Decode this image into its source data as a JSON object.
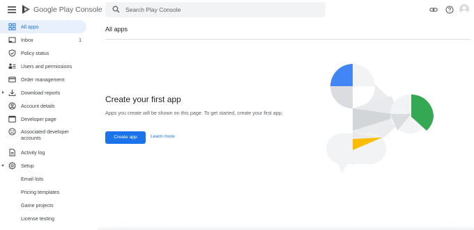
{
  "header": {
    "brand_google": "Google Play",
    "brand_product": "Console",
    "search_placeholder": "Search Play Console",
    "icons": [
      "menu-icon",
      "link-icon",
      "help-icon",
      "avatar"
    ]
  },
  "sidebar": {
    "items": [
      {
        "label": "All apps",
        "icon": "apps-grid-icon",
        "active": true
      },
      {
        "label": "Inbox",
        "icon": "inbox-icon",
        "count": "1"
      },
      {
        "label": "Policy status",
        "icon": "shield-icon"
      },
      {
        "label": "Users and permissions",
        "icon": "users-icon"
      },
      {
        "label": "Order management",
        "icon": "card-icon"
      },
      {
        "label": "Download reports",
        "icon": "download-icon",
        "expandable": true
      },
      {
        "label": "Account details",
        "icon": "account-icon"
      },
      {
        "label": "Developer page",
        "icon": "web-page-icon"
      },
      {
        "label": "Associated developer accounts",
        "label_line1": "Associated developer",
        "label_line2": "accounts",
        "icon": "linked-accounts-icon"
      },
      {
        "label": "Activity log",
        "icon": "document-icon"
      },
      {
        "label": "Setup",
        "icon": "gear-icon",
        "expanded": true
      },
      {
        "label": "Email lists"
      },
      {
        "label": "Pricing templates"
      },
      {
        "label": "Game projects"
      },
      {
        "label": "License testing"
      }
    ]
  },
  "main": {
    "page_title": "All apps",
    "hero_title": "Create your first app",
    "hero_description": "Apps you create will be shown on this page. To get started, create your first app.",
    "create_button": "Create app",
    "learn_more": "Learn more"
  },
  "colors": {
    "accent": "#1a73e8",
    "active_bg": "#e8f0fe",
    "illus_blue": "#4285f4",
    "illus_green": "#34a853",
    "illus_yellow": "#fbbc04",
    "illus_grey": "#dadce0"
  }
}
